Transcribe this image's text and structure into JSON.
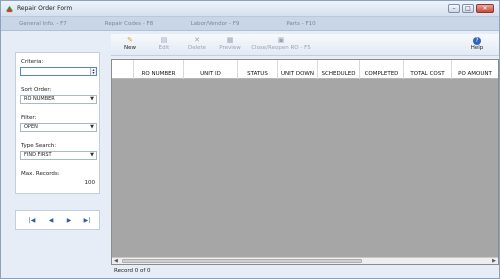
{
  "window": {
    "title": "Repair Order Form"
  },
  "window_buttons": {
    "minimize": "–",
    "maximize": "□",
    "close": "✕"
  },
  "tabs": [
    {
      "label": "General Info. - F7"
    },
    {
      "label": "Repair Codes - F8"
    },
    {
      "label": "Labor/Vendor - F9"
    },
    {
      "label": "Parts - F10"
    }
  ],
  "filters": {
    "criteria_label": "Criteria:",
    "criteria_value": "",
    "sort_label": "Sort Order:",
    "sort_value": "RO NUMBER",
    "filter_label": "Filter:",
    "filter_value": "OPEN",
    "type_search_label": "Type Search:",
    "type_search_value": "FIND FIRST",
    "max_records_label": "Max. Records:",
    "max_records_value": "100"
  },
  "nav": {
    "first": "|◀",
    "prev": "◀",
    "next": "▶",
    "last": "▶|"
  },
  "toolbar": {
    "new": "New",
    "edit": "Edit",
    "delete": "Delete",
    "preview": "Preview",
    "close_reopen": "Close/Reopen RO - F5",
    "help": "Help"
  },
  "grid": {
    "columns": [
      "RO NUMBER",
      "UNIT ID",
      "STATUS",
      "UNIT DOWN",
      "SCHEDULED",
      "COMPLETED",
      "TOTAL COST",
      "PO AMOUNT"
    ]
  },
  "status": {
    "record_text": "Record 0 of 0"
  },
  "colors": {
    "accent": "#2f63c2",
    "grid_bg": "#a6a6a6"
  }
}
